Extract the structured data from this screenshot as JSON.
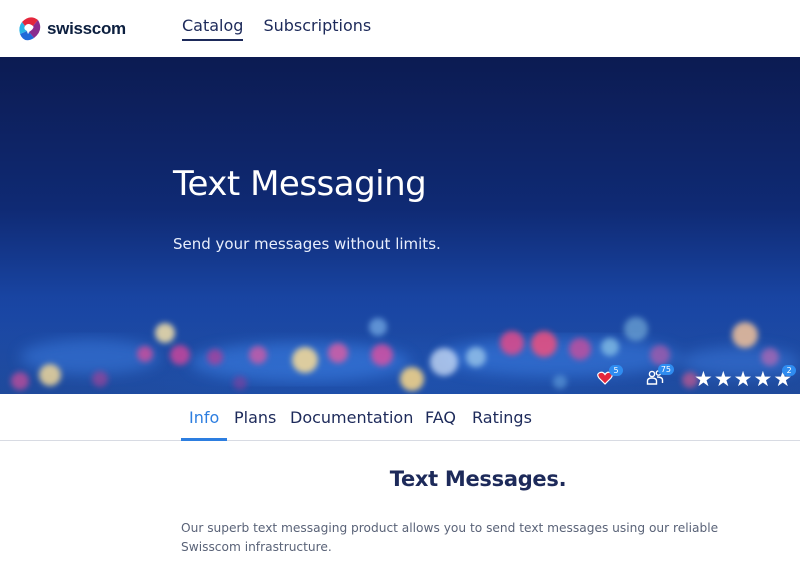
{
  "brand": {
    "name": "swisscom"
  },
  "topnav": [
    {
      "label": "Catalog",
      "active": true
    },
    {
      "label": "Subscriptions",
      "active": false
    }
  ],
  "hero": {
    "title": "Text Messaging",
    "subtitle": "Send your messages without limits."
  },
  "stats": {
    "favorites": {
      "icon": "heart-icon",
      "count": "5"
    },
    "subscribers": {
      "icon": "users-icon",
      "count": "75"
    },
    "rating": {
      "stars": 5,
      "count": "2"
    }
  },
  "tabs": [
    {
      "label": "Info",
      "active": true
    },
    {
      "label": "Plans",
      "active": false
    },
    {
      "label": "Documentation",
      "active": false
    },
    {
      "label": "FAQ",
      "active": false
    },
    {
      "label": "Ratings",
      "active": false
    }
  ],
  "content": {
    "heading": "Text Messages.",
    "description": "Our superb text messaging product allows you to send text messages using our reliable Swisscom infrastructure."
  },
  "colors": {
    "accent": "#2d7ee0",
    "navy": "#1d2a5a",
    "hero_top": "#0c1b52",
    "hero_bottom": "#2a64c8"
  }
}
